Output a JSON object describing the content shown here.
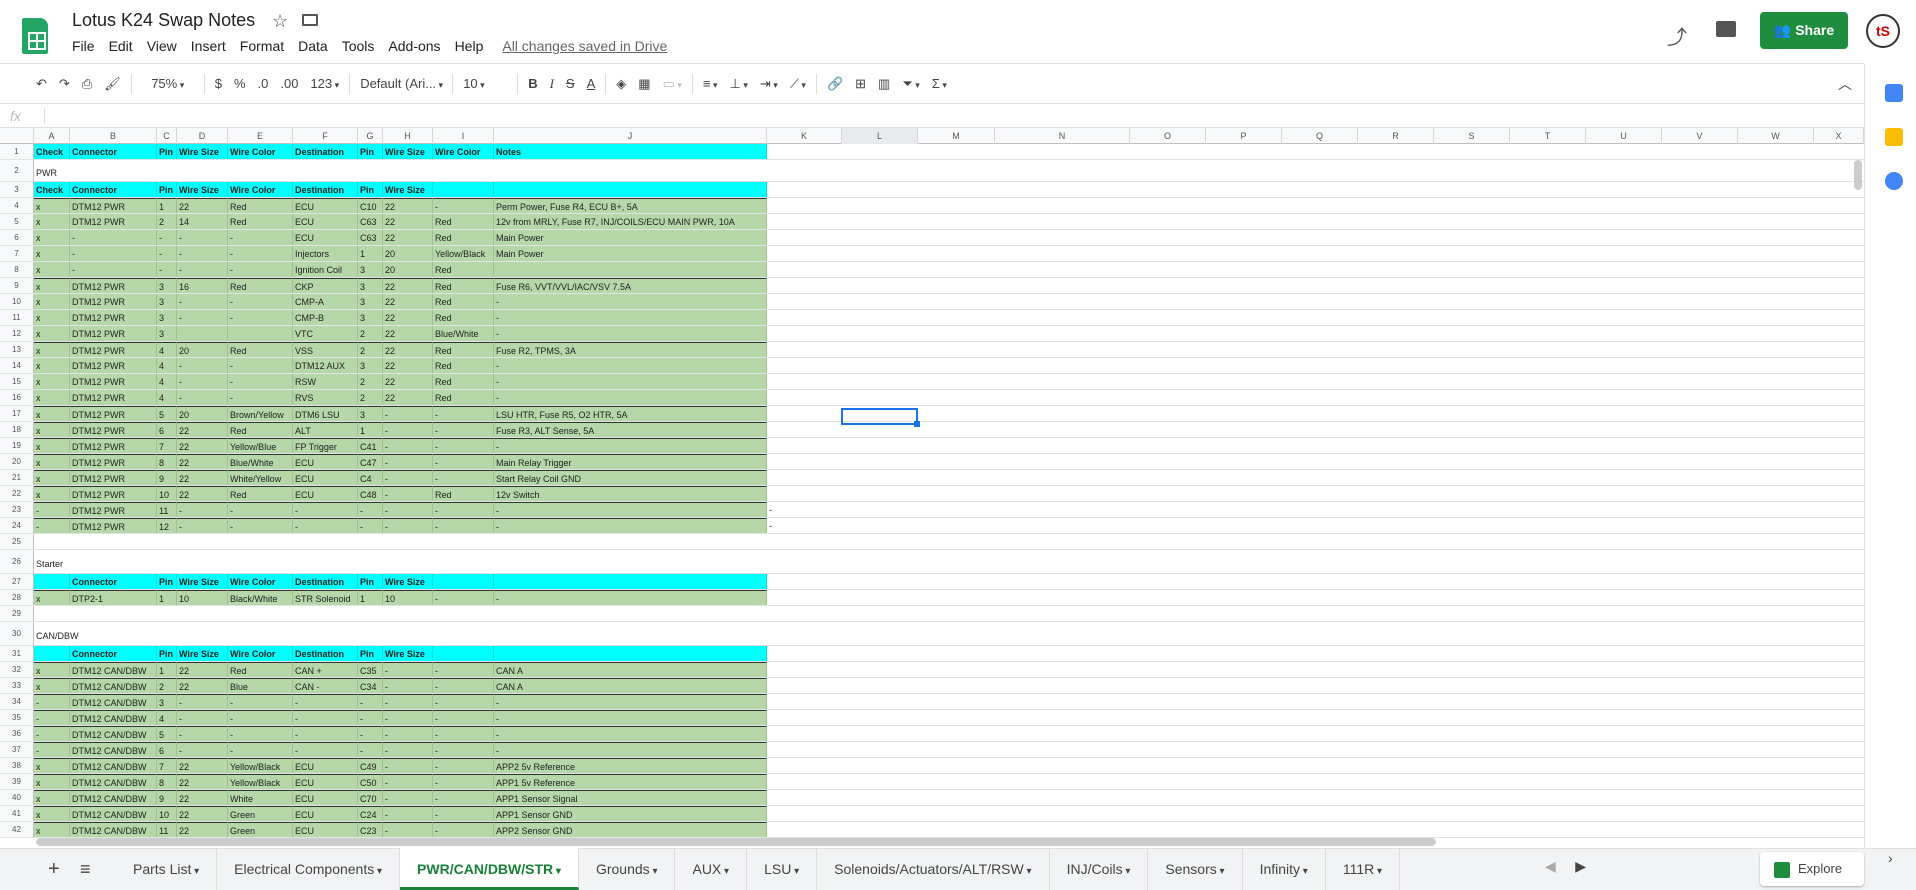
{
  "doc_title": "Lotus K24 Swap Notes",
  "menu": [
    "File",
    "Edit",
    "View",
    "Insert",
    "Format",
    "Data",
    "Tools",
    "Add-ons",
    "Help"
  ],
  "saved_status": "All changes saved in Drive",
  "share_label": "Share",
  "avatar_initials": "tS",
  "toolbar": {
    "zoom": "75%",
    "currency": "$",
    "percent": "%",
    "dec_less": ".0",
    "dec_more": ".00",
    "more_formats": "123",
    "font": "Default (Ari...",
    "font_size": "10",
    "bold": "B",
    "italic": "I",
    "strike": "S",
    "text_color": "A",
    "sigma": "Σ"
  },
  "formula_label": "fx",
  "columns": [
    "A",
    "B",
    "C",
    "D",
    "E",
    "F",
    "G",
    "H",
    "I",
    "J",
    "K",
    "L",
    "M",
    "N",
    "O",
    "P",
    "Q",
    "R",
    "S",
    "T",
    "U",
    "V",
    "W",
    "X"
  ],
  "rows": [
    {
      "n": "1",
      "type": "cyan",
      "cells": [
        "Check",
        "Connector",
        "Pin",
        "Wire Size",
        "Wire Color",
        "Destination",
        "Pin",
        "Wire Size",
        "Wire Color",
        "Notes"
      ]
    },
    {
      "n": "2",
      "type": "section",
      "cells": [
        "PWR"
      ]
    },
    {
      "n": "3",
      "type": "cyan",
      "cells": [
        "Check",
        "Connector",
        "Pin",
        "Wire Size",
        "Wire Color",
        "Destination",
        "Pin",
        "Wire Size",
        "",
        ""
      ]
    },
    {
      "n": "4",
      "type": "green",
      "line": true,
      "cells": [
        "x",
        "DTM12 PWR",
        "1",
        "22",
        "Red",
        "ECU",
        "C10",
        "22",
        "-",
        "Perm Power, Fuse R4, ECU B+, 5A"
      ]
    },
    {
      "n": "5",
      "type": "green",
      "cells": [
        "x",
        "DTM12 PWR",
        "2",
        "14",
        "Red",
        "ECU",
        "C63",
        "22",
        "Red",
        "12v from MRLY, Fuse R7, INJ/COILS/ECU MAIN PWR,  10A"
      ]
    },
    {
      "n": "6",
      "type": "green",
      "cells": [
        "x",
        "-",
        "-",
        "-",
        "-",
        "ECU",
        "C63",
        "22",
        "Red",
        "Main Power"
      ]
    },
    {
      "n": "7",
      "type": "green",
      "cells": [
        "x",
        "-",
        "-",
        "-",
        "-",
        "Injectors",
        "1",
        "20",
        "Yellow/Black",
        "Main Power"
      ]
    },
    {
      "n": "8",
      "type": "green",
      "cells": [
        "x",
        "-",
        "-",
        "-",
        "-",
        "Ignition Coil",
        "3",
        "20",
        "Red",
        ""
      ]
    },
    {
      "n": "9",
      "type": "green",
      "line": true,
      "cells": [
        "x",
        "DTM12 PWR",
        "3",
        "16",
        "Red",
        "CKP",
        "3",
        "22",
        "Red",
        "Fuse R6, VVT/VVL/IAC/VSV 7.5A"
      ]
    },
    {
      "n": "10",
      "type": "green",
      "cells": [
        "x",
        "DTM12 PWR",
        "3",
        "-",
        "-",
        "CMP-A",
        "3",
        "22",
        "Red",
        "-"
      ]
    },
    {
      "n": "11",
      "type": "green",
      "cells": [
        "x",
        "DTM12 PWR",
        "3",
        "-",
        "-",
        "CMP-B",
        "3",
        "22",
        "Red",
        "-"
      ]
    },
    {
      "n": "12",
      "type": "green",
      "cells": [
        "x",
        "DTM12 PWR",
        "3",
        "",
        "",
        "VTC",
        "2",
        "22",
        "Blue/White",
        "-"
      ]
    },
    {
      "n": "13",
      "type": "green",
      "line": true,
      "cells": [
        "x",
        "DTM12 PWR",
        "4",
        "20",
        "Red",
        "VSS",
        "2",
        "22",
        "Red",
        "Fuse R2, TPMS, 3A"
      ]
    },
    {
      "n": "14",
      "type": "green",
      "cells": [
        "x",
        "DTM12 PWR",
        "4",
        "-",
        "-",
        "DTM12 AUX",
        "3",
        "22",
        "Red",
        "-"
      ]
    },
    {
      "n": "15",
      "type": "green",
      "cells": [
        "x",
        "DTM12 PWR",
        "4",
        "-",
        "-",
        "RSW",
        "2",
        "22",
        "Red",
        "-"
      ]
    },
    {
      "n": "16",
      "type": "green",
      "cells": [
        "x",
        "DTM12 PWR",
        "4",
        "-",
        "-",
        "RVS",
        "2",
        "22",
        "Red",
        "-"
      ]
    },
    {
      "n": "17",
      "type": "green",
      "line": true,
      "cells": [
        "x",
        "DTM12 PWR",
        "5",
        "20",
        "Brown/Yellow",
        "DTM6 LSU",
        "3",
        "-",
        "-",
        "LSU HTR, Fuse R5, O2 HTR, 5A"
      ]
    },
    {
      "n": "18",
      "type": "green",
      "line": true,
      "cells": [
        "x",
        "DTM12 PWR",
        "6",
        "22",
        "Red",
        "ALT",
        "1",
        "-",
        "-",
        "Fuse R3, ALT Sense, 5A"
      ]
    },
    {
      "n": "19",
      "type": "green",
      "line": true,
      "cells": [
        "x",
        "DTM12 PWR",
        "7",
        "22",
        "Yellow/Blue",
        "FP Trigger",
        "C41",
        "-",
        "-",
        "-"
      ]
    },
    {
      "n": "20",
      "type": "green",
      "line": true,
      "cells": [
        "x",
        "DTM12 PWR",
        "8",
        "22",
        "Blue/White",
        "ECU",
        "C47",
        "-",
        "-",
        "Main Relay Trigger"
      ]
    },
    {
      "n": "21",
      "type": "green",
      "line": true,
      "cells": [
        "x",
        "DTM12 PWR",
        "9",
        "22",
        "White/Yellow",
        "ECU",
        "C4",
        "-",
        "-",
        "Start Relay Coil GND"
      ]
    },
    {
      "n": "22",
      "type": "green",
      "line": true,
      "cells": [
        "x",
        "DTM12 PWR",
        "10",
        "22",
        "Red",
        "ECU",
        "C48",
        "-",
        "Red",
        "12v Switch"
      ]
    },
    {
      "n": "23",
      "type": "green",
      "line": true,
      "cells": [
        "-",
        "DTM12 PWR",
        "11",
        "-",
        "-",
        "-",
        "-",
        "-",
        "-",
        "-"
      ],
      "k": "-"
    },
    {
      "n": "24",
      "type": "green",
      "line": true,
      "cells": [
        "-",
        "DTM12 PWR",
        "12",
        "-",
        "-",
        "-",
        "-",
        "-",
        "-",
        "-"
      ],
      "k": "-"
    },
    {
      "n": "25",
      "type": "blank",
      "cells": []
    },
    {
      "n": "26",
      "type": "section",
      "cells": [
        "Starter"
      ]
    },
    {
      "n": "27",
      "type": "cyan",
      "cells": [
        "",
        "Connector",
        "Pin",
        "Wire Size",
        "Wire Color",
        "Destination",
        "Pin",
        "Wire Size",
        "",
        ""
      ]
    },
    {
      "n": "28",
      "type": "green",
      "line": true,
      "cells": [
        "x",
        "DTP2-1",
        "1",
        "10",
        "Black/White",
        "STR Solenoid",
        "1",
        "10",
        "-",
        "-"
      ]
    },
    {
      "n": "29",
      "type": "blank",
      "cells": []
    },
    {
      "n": "30",
      "type": "section",
      "cells": [
        "CAN/DBW"
      ]
    },
    {
      "n": "31",
      "type": "cyan",
      "cells": [
        "",
        "Connector",
        "Pin",
        "Wire Size",
        "Wire Color",
        "Destination",
        "Pin",
        "Wire Size",
        "",
        ""
      ]
    },
    {
      "n": "32",
      "type": "green",
      "line": true,
      "cells": [
        "x",
        "DTM12 CAN/DBW",
        "1",
        "22",
        "Red",
        "CAN +",
        "C35",
        "-",
        "-",
        "CAN A"
      ]
    },
    {
      "n": "33",
      "type": "green",
      "line": true,
      "cells": [
        "x",
        "DTM12 CAN/DBW",
        "2",
        "22",
        "Blue",
        "CAN -",
        "C34",
        "-",
        "-",
        "CAN A"
      ]
    },
    {
      "n": "34",
      "type": "green",
      "line": true,
      "cells": [
        "-",
        "DTM12 CAN/DBW",
        "3",
        "-",
        "-",
        "-",
        "-",
        "-",
        "-",
        "-"
      ]
    },
    {
      "n": "35",
      "type": "green",
      "line": true,
      "cells": [
        "-",
        "DTM12 CAN/DBW",
        "4",
        "-",
        "-",
        "-",
        "-",
        "-",
        "-",
        "-"
      ]
    },
    {
      "n": "36",
      "type": "green",
      "line": true,
      "cells": [
        "-",
        "DTM12 CAN/DBW",
        "5",
        "-",
        "-",
        "-",
        "-",
        "-",
        "-",
        "-"
      ]
    },
    {
      "n": "37",
      "type": "green",
      "line": true,
      "cells": [
        "-",
        "DTM12 CAN/DBW",
        "6",
        "-",
        "-",
        "-",
        "-",
        "-",
        "-",
        "-"
      ]
    },
    {
      "n": "38",
      "type": "green",
      "line": true,
      "cells": [
        "x",
        "DTM12 CAN/DBW",
        "7",
        "22",
        "Yellow/Black",
        "ECU",
        "C49",
        "-",
        "-",
        "APP2 5v Reference"
      ]
    },
    {
      "n": "39",
      "type": "green",
      "line": true,
      "cells": [
        "x",
        "DTM12 CAN/DBW",
        "8",
        "22",
        "Yellow/Black",
        "ECU",
        "C50",
        "-",
        "-",
        "APP1 5v Reference"
      ]
    },
    {
      "n": "40",
      "type": "green",
      "line": true,
      "cells": [
        "x",
        "DTM12 CAN/DBW",
        "9",
        "22",
        "White",
        "ECU",
        "C70",
        "-",
        "-",
        "APP1 Sensor Signal"
      ]
    },
    {
      "n": "41",
      "type": "green",
      "line": true,
      "cells": [
        "x",
        "DTM12 CAN/DBW",
        "10",
        "22",
        "Green",
        "ECU",
        "C24",
        "-",
        "-",
        "APP1 Sensor GND"
      ]
    },
    {
      "n": "42",
      "type": "green",
      "line": true,
      "cells": [
        "x",
        "DTM12 CAN/DBW",
        "11",
        "22",
        "Green",
        "ECU",
        "C23",
        "-",
        "-",
        "APP2 Sensor GND"
      ]
    }
  ],
  "tabs": [
    "Parts List",
    "Electrical Components",
    "PWR/CAN/DBW/STR",
    "Grounds",
    "AUX",
    "LSU",
    "Solenoids/Actuators/ALT/RSW",
    "INJ/Coils",
    "Sensors",
    "Infinity",
    "111R"
  ],
  "active_tab": "PWR/CAN/DBW/STR",
  "explore_label": "Explore",
  "colors": {
    "header_cyan": "#00ffff",
    "row_green": "#b6d7a8",
    "brand_green": "#1e8e3e",
    "selection": "#1a73e8"
  }
}
